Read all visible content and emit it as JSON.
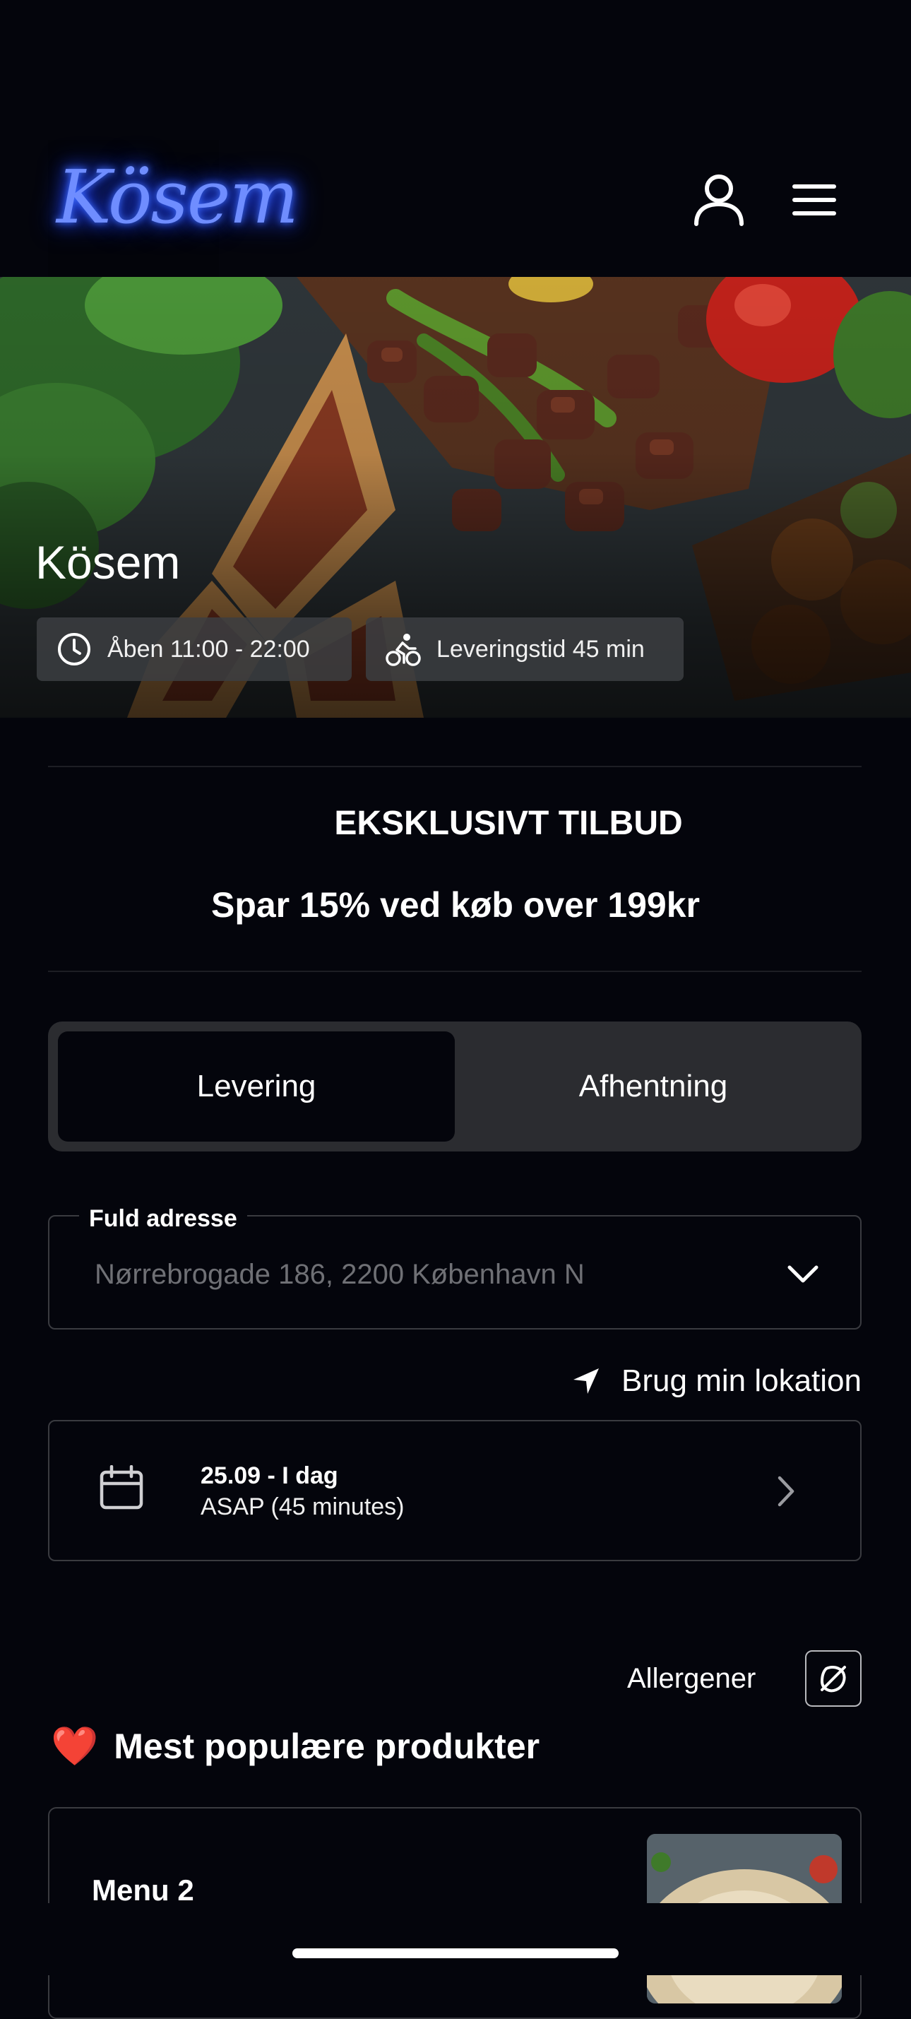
{
  "header": {
    "logo_text": "Kösem",
    "user_icon": "user-icon",
    "menu_icon": "hamburger-menu-icon"
  },
  "hero": {
    "restaurant_name": "Kösem",
    "opening_hours": "Åben 11:00 - 22:00",
    "delivery_time": "Leveringstid 45 min",
    "clock_icon": "clock-icon",
    "delivery_icon": "bicycle-courier-icon"
  },
  "offer": {
    "title": "EKSKLUSIVT TILBUD",
    "subtitle": "Spar 15% ved køb over 199kr"
  },
  "order_type": {
    "options": [
      "Levering",
      "Afhentning"
    ],
    "selected": "Levering"
  },
  "address": {
    "label": "Fuld adresse",
    "placeholder": "Nørrebrogade 186, 2200 København N"
  },
  "location": {
    "label": "Brug min lokation",
    "icon": "location-arrow-icon"
  },
  "date_picker": {
    "date": "25.09 - I dag",
    "time": "ASAP (45 minutes)",
    "icon": "calendar-icon"
  },
  "allergens": {
    "label": "Allergener",
    "icon": "allergen-filter-icon"
  },
  "popular": {
    "emoji": "❤️",
    "title": "Mest populære produkter",
    "products": [
      {
        "name": "Menu 2"
      }
    ]
  },
  "colors": {
    "background": "#04050c",
    "surface": "#2b2c30",
    "border": "#3a3b40",
    "text": "#ffffff",
    "muted_text": "#6f7075",
    "logo_glow": "#3f6dff"
  }
}
